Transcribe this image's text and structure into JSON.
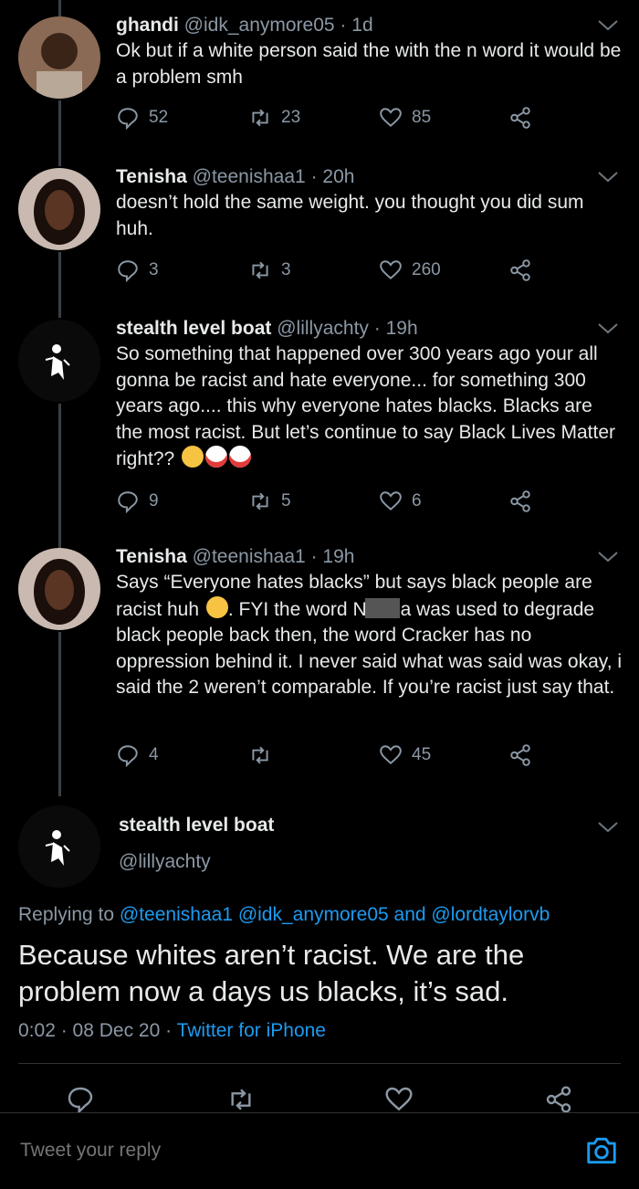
{
  "thread": [
    {
      "name": "ghandi",
      "handle": "@idk_anymore05",
      "time": "1d",
      "text": "Ok but if a white person said the with the n word it would be a problem smh",
      "replies": "52",
      "retweets": "23",
      "likes": "85"
    },
    {
      "name": "Tenisha",
      "handle": "@teenishaa1",
      "time": "20h",
      "text": "doesn’t hold the same weight. you thought you did sum huh.",
      "replies": "3",
      "retweets": "3",
      "likes": "260"
    },
    {
      "name": "stealth level boat",
      "handle": "@lillyachty",
      "time": "19h",
      "text": "So something that happened over 300 years ago your all gonna be racist and hate everyone... for something 300 years ago.... this why everyone hates blacks. Blacks are the most racist. But let’s continue to say Black Lives Matter right??",
      "emojis": [
        "rofl-emoji",
        "clown-emoji",
        "clown-emoji"
      ],
      "replies": "9",
      "retweets": "5",
      "likes": "6"
    },
    {
      "name": "Tenisha",
      "handle": "@teenishaa1",
      "time": "19h",
      "text_a": "Says “Everyone hates blacks” but says black people are racist huh ",
      "text_b": ". FYI the word N",
      "text_c": "a was used to degrade black people back then, the word Cracker has no oppression behind it. I never said what was said was okay, i said the 2 weren’t comparable. If you’re racist just say that.",
      "replies": "4",
      "retweets": "",
      "likes": "45"
    }
  ],
  "main": {
    "name": "stealth level boat",
    "handle": "@lillyachty",
    "replying_prefix": "Replying to ",
    "replying_to": "@teenishaa1 @idk_anymore05 and @lordtaylorvb",
    "text": "Because whites aren’t racist. We are the problem now a days us blacks, it’s sad.",
    "time": "0:02",
    "date": "08 Dec 20",
    "source": "Twitter for iPhone"
  },
  "reply_bar": {
    "placeholder": "Tweet your reply"
  },
  "colors": {
    "background": "#000000",
    "text": "#e7e9ea",
    "muted": "#8b98a5",
    "link": "#1d9bf0"
  }
}
